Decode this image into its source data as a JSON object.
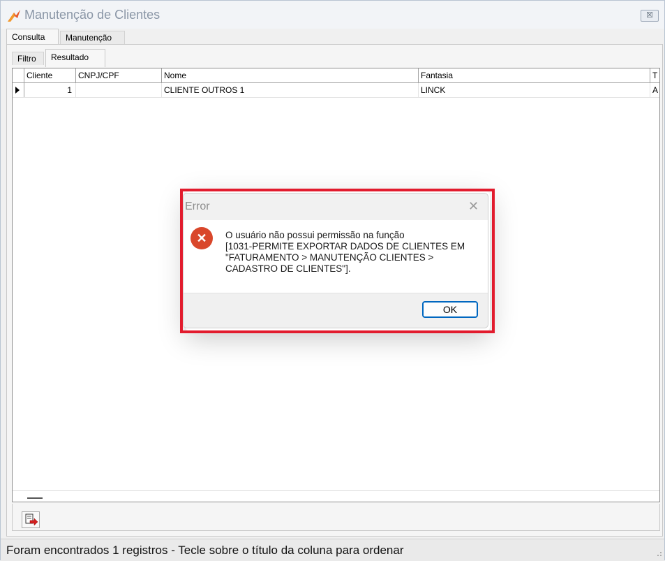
{
  "window": {
    "title": "Manutenção de Clientes",
    "close_label": "☒"
  },
  "tabs_main": [
    {
      "label": "Consulta",
      "active": true
    },
    {
      "label": "Manutenção",
      "active": false
    }
  ],
  "tabs_sub": [
    {
      "label": "Filtro",
      "active": false
    },
    {
      "label": "Resultado",
      "active": true
    }
  ],
  "grid": {
    "columns": [
      "Cliente",
      "CNPJ/CPF",
      "Nome",
      "Fantasia",
      "T"
    ],
    "rows": [
      {
        "cliente": "1",
        "cnpj": "",
        "nome": "CLIENTE OUTROS 1",
        "fantasia": "LINCK",
        "t": "A"
      }
    ]
  },
  "status_bar": {
    "text": "Foram encontrados 1 registros  - Tecle sobre o título da coluna para ordenar"
  },
  "dialog": {
    "title": "Error",
    "close_label": "✕",
    "icon": "error-icon",
    "message_lines": [
      "O usuário não possui permissão na função",
      "[1031-PERMITE EXPORTAR DADOS DE CLIENTES EM",
      "\"FATURAMENTO > MANUTENÇÃO CLIENTES >",
      "CADASTRO DE CLIENTES\"]."
    ],
    "ok_label": "OK"
  },
  "colors": {
    "highlight": "#e21b2d",
    "error_icon": "#d9472b",
    "ok_border": "#0067c0"
  },
  "icons": {
    "app": "app-logo-icon",
    "export": "export-icon",
    "row_pointer": "row-pointer-icon"
  }
}
